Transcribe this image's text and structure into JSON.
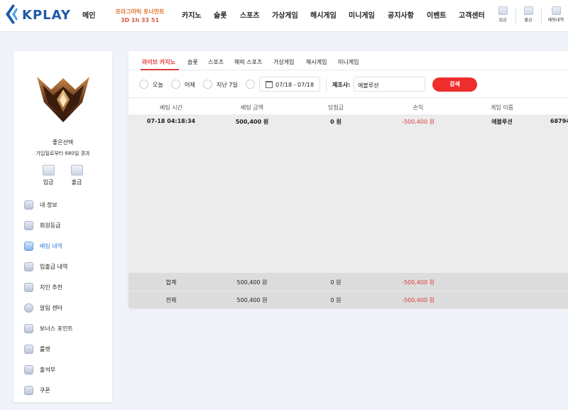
{
  "header": {
    "logo_text": "KPLAY",
    "nav": [
      "메인",
      "카지노",
      "슬롯",
      "스포츠",
      "가상게임",
      "해시게임",
      "미니게임",
      "공지사항",
      "이벤트",
      "고객센터"
    ],
    "promo_line1": "프라그마틱 토너먼트",
    "promo_line2": "3D 1h 33 51",
    "buttons": [
      "입금",
      "출금",
      "베팅내역"
    ]
  },
  "sidebar": {
    "user_name": "좋은선택",
    "user_sub": "가입일로부터 680일 경과",
    "quick": [
      "입금",
      "출금"
    ],
    "menu": [
      {
        "label": "내 정보",
        "icon": "user-icon"
      },
      {
        "label": "회원등급",
        "icon": "grade-icon"
      },
      {
        "label": "베팅 내역",
        "icon": "betting-icon"
      },
      {
        "label": "입출금 내역",
        "icon": "wallet-icon"
      },
      {
        "label": "지인 추천",
        "icon": "referral-icon"
      },
      {
        "label": "알림 센터",
        "icon": "chat-icon"
      },
      {
        "label": "보너스 포인트",
        "icon": "bonus-icon"
      },
      {
        "label": "룰렛",
        "icon": "roulette-icon"
      },
      {
        "label": "출석부",
        "icon": "attendance-icon"
      },
      {
        "label": "쿠폰",
        "icon": "coupon-icon"
      }
    ],
    "active_index": 2
  },
  "tabs": [
    "라이브 카지노",
    "슬롯",
    "스포츠",
    "해외 스포츠",
    "가상게임",
    "해시게임",
    "미니게임"
  ],
  "filters": {
    "radios": [
      "오늘",
      "어제",
      "지난 7일"
    ],
    "date_range": "07/18 - 07/18",
    "provider_label": "제조사:",
    "provider_value": "에볼루션",
    "search_label": "검색"
  },
  "table": {
    "columns": [
      "베팅 시간",
      "베팅 금액",
      "당첨금",
      "손익",
      "게임 이름"
    ],
    "rows": [
      {
        "time": "07-18 04:18:34",
        "bet": "500,400 원",
        "win": "0 원",
        "profit": "-500,400 원",
        "game": "에볼루션",
        "extra": "68794"
      }
    ],
    "summary": [
      {
        "label": "합계",
        "bet": "500,400 원",
        "win": "0 원",
        "profit": "-500,400 원"
      },
      {
        "label": "전체",
        "bet": "500,400 원",
        "win": "0 원",
        "profit": "-500,400 원"
      }
    ]
  },
  "colors": {
    "brand": "#1f5aa8",
    "accent_red": "#e03b3b",
    "active_blue": "#2a7de1"
  }
}
